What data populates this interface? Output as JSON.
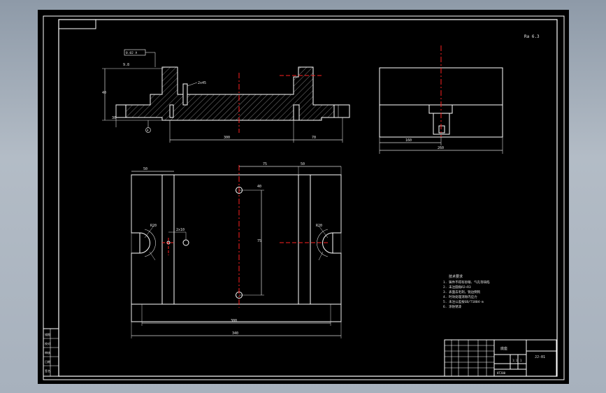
{
  "colors": {
    "background": "#000000",
    "line": "#ffffff",
    "center_line": "#ff2020",
    "dimension": "#e6e6e6",
    "hatch": "#d8d8d8"
  },
  "front_view": {
    "dim_overall": "300",
    "dim_right": "70",
    "dim_depth": "2x45",
    "dim_height": "40",
    "dim_left_small": "9.8",
    "dim_left_height": "30",
    "tolerance_frame": "0.02 A",
    "datum_label": "A"
  },
  "side_view": {
    "dim_width": "260",
    "dim_inner": "160"
  },
  "top_view": {
    "dim_overall": "340",
    "dim_inner": "300",
    "dim_left": "50",
    "dim_top_right": "50",
    "dim_top_mid": "75",
    "dim_hole_spacing": "75",
    "dim_hole_offset": "40",
    "dim_slot_left": "R20",
    "dim_slot_right": "R20",
    "dim_hole_small": "2x10"
  },
  "roughness_note": "Ra 6.3",
  "notes": [
    "技术要求",
    "1. 铸件不得有砂眼、气孔等缺陷",
    "2. 未注圆角R2~R3",
    "3. 表面去毛刺，锐边倒钝",
    "4. 时效处理消除内应力",
    "5. 未注公差按GB/T1804-m",
    "6. 涂防锈漆"
  ],
  "title_block": {
    "part_name": "底座",
    "drawing_no": "JJ-01",
    "scale": "1:1",
    "sheet": "1",
    "material": "HT200"
  },
  "side_stamp": [
    "描图",
    "校对",
    "审核",
    "日期",
    "签名"
  ]
}
